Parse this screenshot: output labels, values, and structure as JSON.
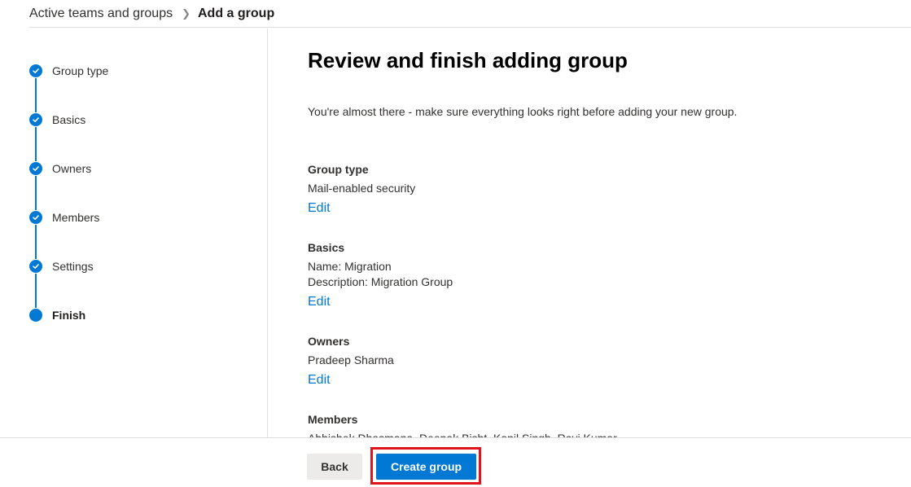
{
  "breadcrumb": {
    "parent": "Active teams and groups",
    "separator": ">",
    "current": "Add a group"
  },
  "steps": [
    {
      "label": "Group type",
      "status": "completed",
      "icon": "check-icon"
    },
    {
      "label": "Basics",
      "status": "completed",
      "icon": "check-icon"
    },
    {
      "label": "Owners",
      "status": "completed",
      "icon": "check-icon"
    },
    {
      "label": "Members",
      "status": "completed",
      "icon": "check-icon"
    },
    {
      "label": "Settings",
      "status": "completed",
      "icon": "check-icon"
    },
    {
      "label": "Finish",
      "status": "current",
      "icon": "current-step-dot"
    }
  ],
  "main": {
    "title": "Review and finish adding group",
    "subtitle": "You're almost there - make sure everything looks right before adding your new group.",
    "sections": [
      {
        "heading": "Group type",
        "lines": [
          "Mail-enabled security"
        ],
        "edit_label": "Edit"
      },
      {
        "heading": "Basics",
        "lines": [
          "Name: Migration",
          "Description: Migration Group"
        ],
        "edit_label": "Edit"
      },
      {
        "heading": "Owners",
        "lines": [
          "Pradeep Sharma"
        ],
        "edit_label": "Edit"
      },
      {
        "heading": "Members",
        "lines": [
          "Abhishek Dhasmana, Deepak Bisht, Kapil Singh, Ravi Kumar"
        ]
      }
    ]
  },
  "footer": {
    "back_label": "Back",
    "create_label": "Create group"
  },
  "colors": {
    "accent": "#0078d4",
    "highlight": "#e3131e"
  }
}
